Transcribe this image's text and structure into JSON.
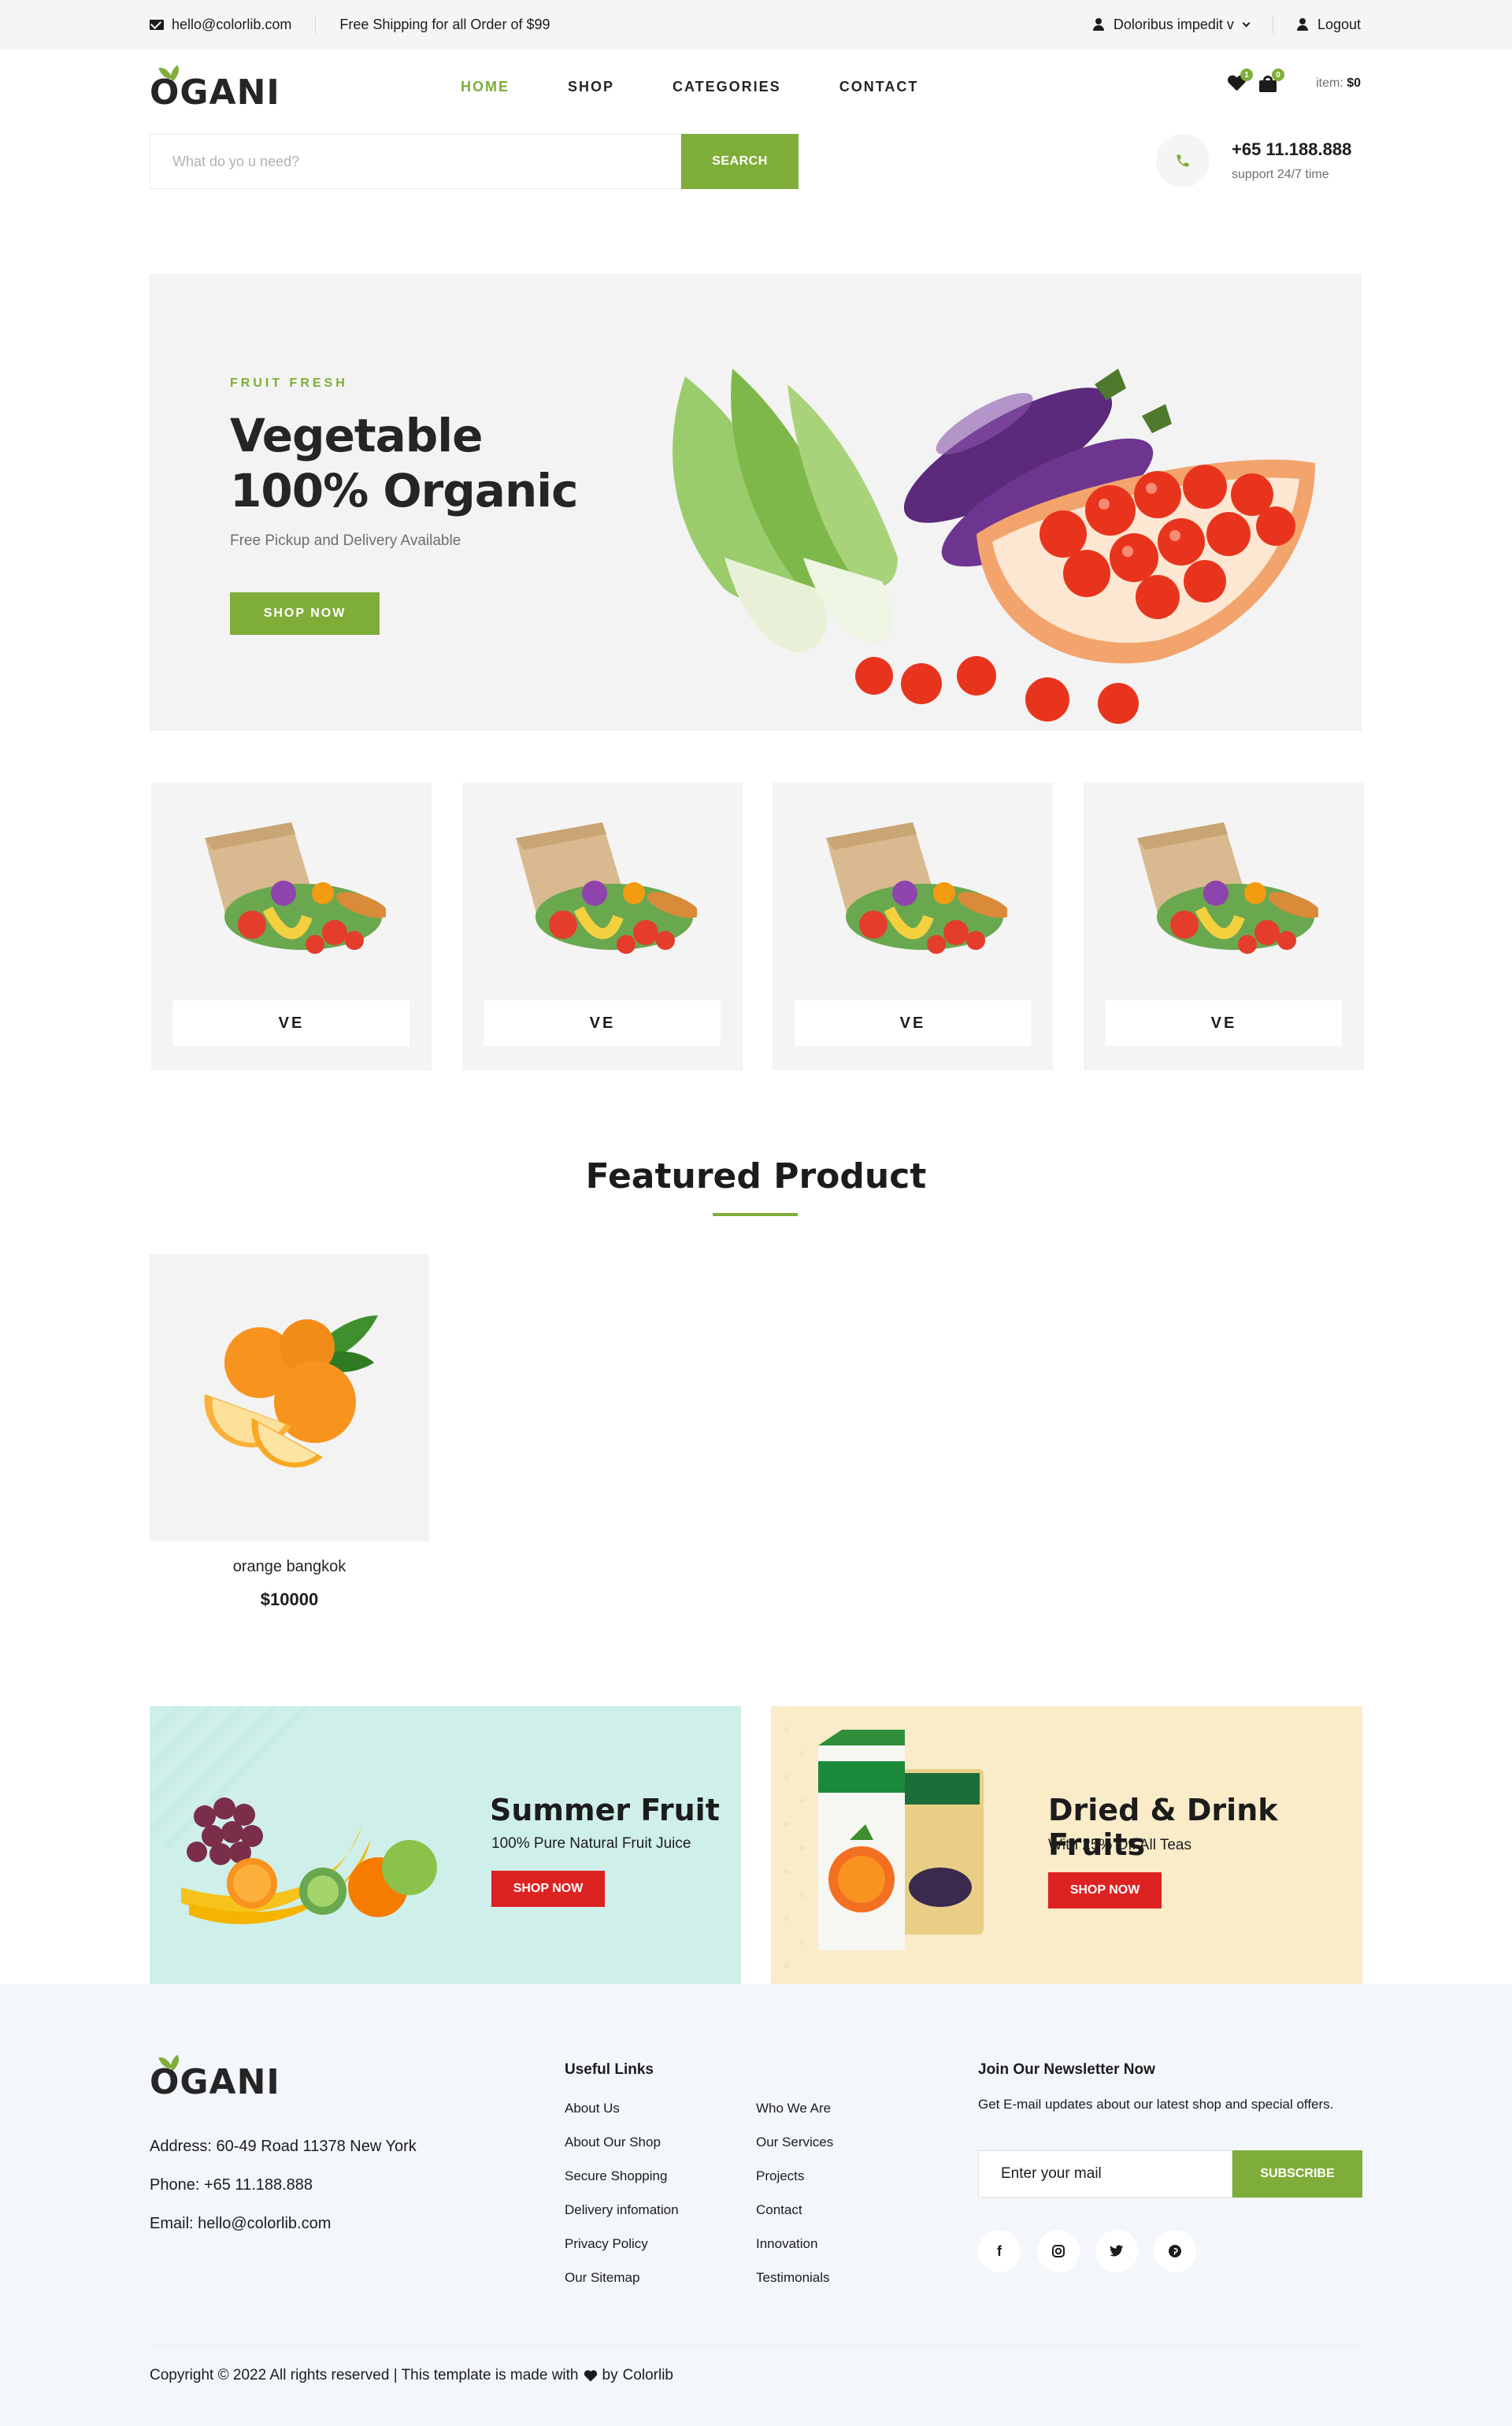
{
  "topbar": {
    "email": "hello@colorlib.com",
    "shipping": "Free Shipping for all Order of $99",
    "user": "Doloribus impedit v",
    "logout": "Logout"
  },
  "logo": {
    "text": "OGANI"
  },
  "nav": {
    "home": "HOME",
    "shop": "SHOP",
    "categories": "CATEGORIES",
    "contact": "CONTACT"
  },
  "cart": {
    "wishlist_count": "1",
    "cart_count": "0",
    "label": "item:",
    "total": "$0"
  },
  "search": {
    "placeholder": "What do yo u need?",
    "button": "SEARCH"
  },
  "phone": {
    "number": "+65 11.188.888",
    "support": "support 24/7 time"
  },
  "hero": {
    "tag": "FRUIT FRESH",
    "title_line1": "Vegetable",
    "title_line2": "100% Organic",
    "description": "Free Pickup and Delivery Available",
    "button": "SHOP NOW"
  },
  "categories": [
    {
      "label": "VE"
    },
    {
      "label": "VE"
    },
    {
      "label": "VE"
    },
    {
      "label": "VE"
    }
  ],
  "featured": {
    "title": "Featured Product",
    "products": [
      {
        "name": "orange bangkok",
        "price": "$10000"
      }
    ]
  },
  "banners": [
    {
      "title": "Summer Fruit",
      "subtitle": "100% Pure Natural Fruit Juice",
      "button": "SHOP NOW"
    },
    {
      "title": "Dried & Drink Fruits",
      "subtitle": "With 25% Off All Teas",
      "button": "SHOP NOW"
    }
  ],
  "footer": {
    "address": "Address: 60-49 Road 11378 New York",
    "phone": "Phone: +65 11.188.888",
    "email": "Email: hello@colorlib.com",
    "links_title": "Useful Links",
    "links_col1": [
      "About Us",
      "About Our Shop",
      "Secure Shopping",
      "Delivery infomation",
      "Privacy Policy",
      "Our Sitemap"
    ],
    "links_col2": [
      "Who We Are",
      "Our Services",
      "Projects",
      "Contact",
      "Innovation",
      "Testimonials"
    ],
    "newsletter_title": "Join Our Newsletter Now",
    "newsletter_text": "Get E-mail updates about our latest shop and special offers.",
    "newsletter_placeholder": "Enter your mail",
    "subscribe": "SUBSCRIBE",
    "social_icons": [
      "facebook-icon",
      "instagram-icon",
      "twitter-icon",
      "pinterest-icon"
    ],
    "copyright": "Copyright © 2022 All rights reserved | This template is made with",
    "copyright_by": "by",
    "copyright_brand": "Colorlib"
  },
  "colors": {
    "accent": "#7fad39",
    "banner_button": "#dd2222",
    "topbar_bg": "#f5f5f5",
    "footer_bg": "#f3f6fa"
  }
}
